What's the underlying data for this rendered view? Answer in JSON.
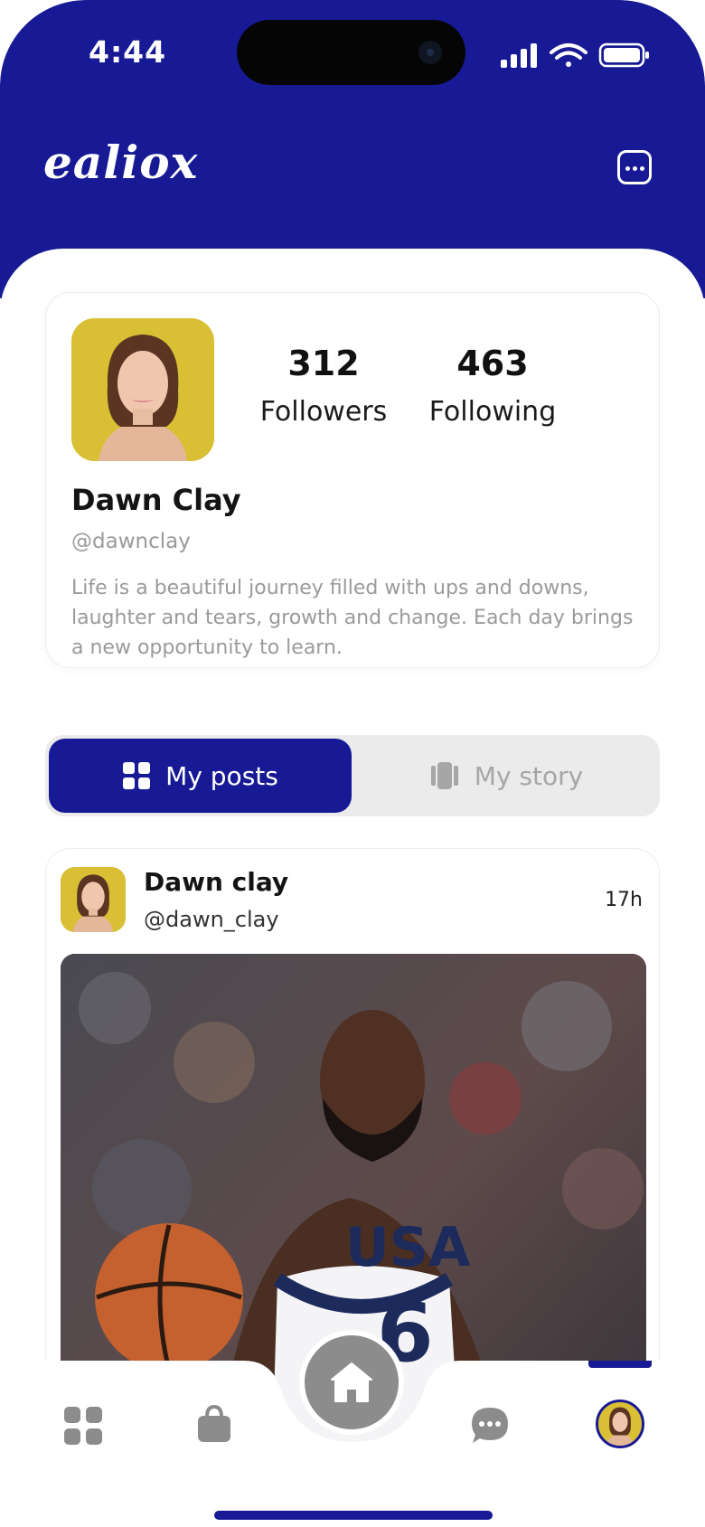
{
  "status_bar": {
    "time": "4:44"
  },
  "app": {
    "brand": "ealiox"
  },
  "profile": {
    "followers_count": "312",
    "followers_label": "Followers",
    "following_count": "463",
    "following_label": "Following",
    "name": "Dawn Clay",
    "handle": "@dawnclay",
    "bio": "Life is a beautiful journey filled with ups and downs, laughter and tears, growth and change. Each day brings a new opportunity to learn."
  },
  "tabs": [
    {
      "label": "My posts",
      "active": true
    },
    {
      "label": "My story",
      "active": false
    }
  ],
  "post": {
    "author_name": "Dawn clay",
    "author_handle": "@dawn_clay",
    "time_ago": "17h",
    "jersey_text": "USA",
    "jersey_number": "6"
  },
  "bottom_nav": {
    "items": [
      {
        "icon": "grid-icon"
      },
      {
        "icon": "shopping-bag-icon"
      },
      {
        "icon": "home-icon",
        "active": true
      },
      {
        "icon": "chat-icon"
      },
      {
        "icon": "profile-avatar"
      }
    ]
  },
  "colors": {
    "primary": "#171a94",
    "inactive_icon": "#8c8c8c",
    "muted_text": "#9a9a9a",
    "tab_background": "#ebebeb"
  }
}
